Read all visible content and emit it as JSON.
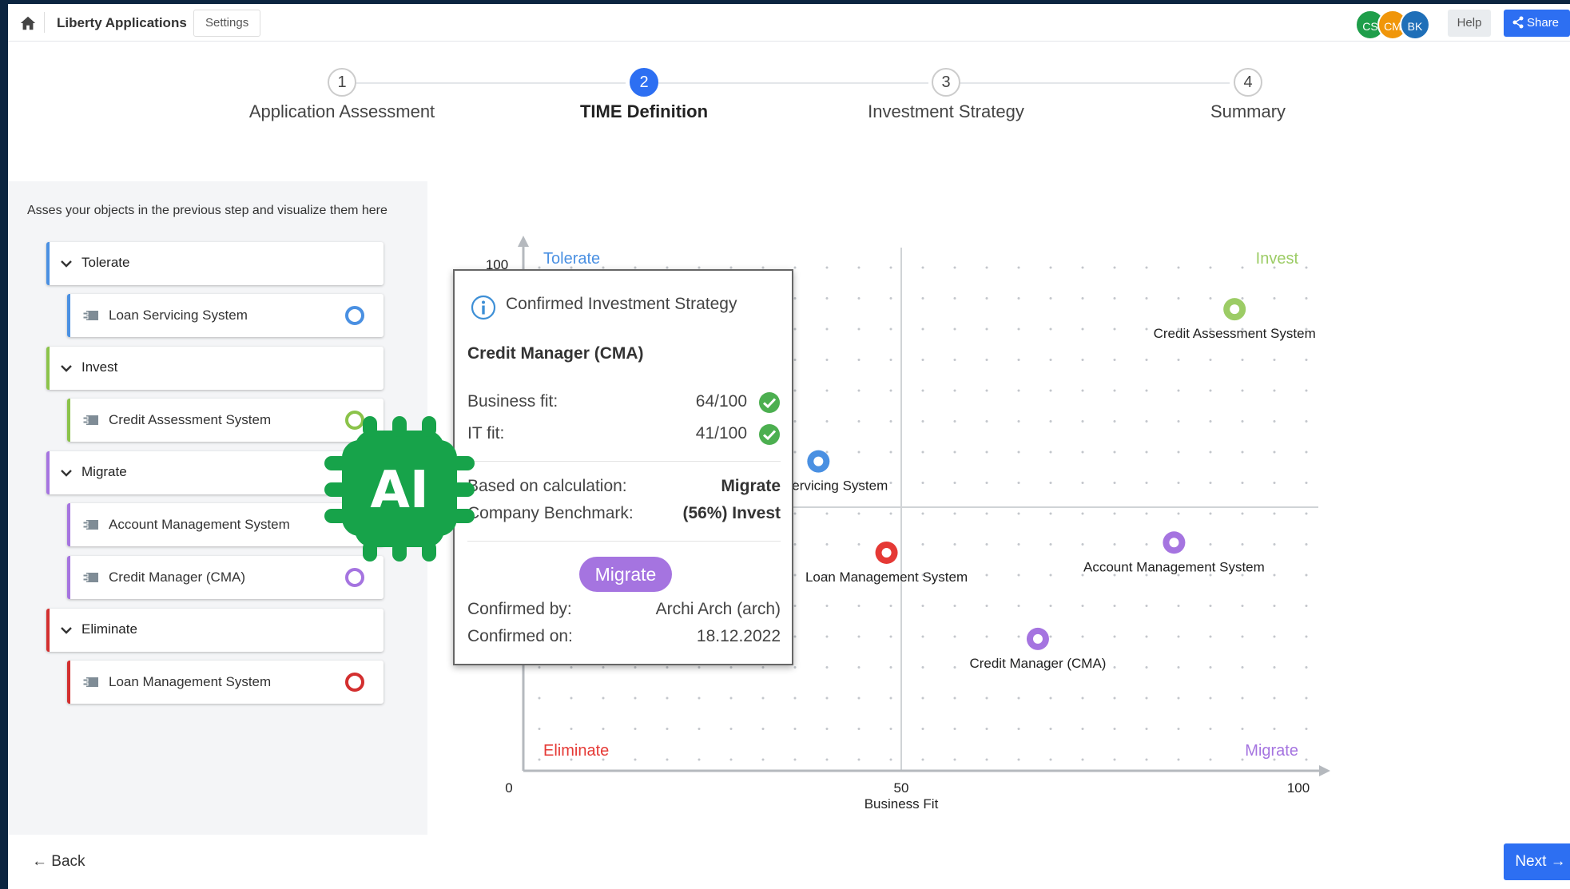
{
  "topbar": {
    "home_icon": "home-icon",
    "app_title": "Liberty Applications",
    "settings_label": "Settings",
    "avatars": [
      {
        "initials": "CS",
        "color": "#1e9e4a"
      },
      {
        "initials": "CM",
        "color": "#f0960a"
      },
      {
        "initials": "BK",
        "color": "#1f6fb8"
      }
    ],
    "help_label": "Help",
    "share_label": "Share"
  },
  "stepper": {
    "steps": [
      {
        "number": "1",
        "label": "Application Assessment",
        "active": false
      },
      {
        "number": "2",
        "label": "TIME Definition",
        "active": true
      },
      {
        "number": "3",
        "label": "Investment Strategy",
        "active": false
      },
      {
        "number": "4",
        "label": "Summary",
        "active": false
      }
    ]
  },
  "left_panel": {
    "intro": "Asses your objects in the previous step and visualize them here",
    "groups": [
      {
        "label": "Tolerate",
        "color": "#4a90e2",
        "items": [
          {
            "label": "Loan Servicing System"
          }
        ]
      },
      {
        "label": "Invest",
        "color": "#8bc34a",
        "items": [
          {
            "label": "Credit Assessment System"
          }
        ]
      },
      {
        "label": "Migrate",
        "color": "#a574e0",
        "items": [
          {
            "label": "Account Management System"
          },
          {
            "label": "Credit Manager (CMA)"
          }
        ]
      },
      {
        "label": "Eliminate",
        "color": "#d32f2f",
        "items": [
          {
            "label": "Loan Management System"
          }
        ]
      }
    ]
  },
  "chart_data": {
    "type": "scatter",
    "xlabel": "Business Fit",
    "ylabel": "",
    "xlim": [
      0,
      100
    ],
    "ylim": [
      0,
      100
    ],
    "x_ticks": [
      "0",
      "50",
      "100"
    ],
    "y_ticks": [
      "100"
    ],
    "grid": true,
    "quadrants": [
      {
        "label": "Tolerate",
        "position": "top-left",
        "color": "#4a90e2"
      },
      {
        "label": "Invest",
        "position": "top-right",
        "color": "#9ccc65"
      },
      {
        "label": "Eliminate",
        "position": "bottom-left",
        "color": "#e53935"
      },
      {
        "label": "Migrate",
        "position": "bottom-right",
        "color": "#a574e0"
      }
    ],
    "points": [
      {
        "label": "Credit Assessment System",
        "x": 94,
        "y": 91,
        "color": "#9ccc65"
      },
      {
        "label": "Loan Servicing System",
        "x": 39,
        "y": 61,
        "color": "#4a90e2"
      },
      {
        "label": "Loan Management System",
        "x": 48,
        "y": 43,
        "color": "#e53935"
      },
      {
        "label": "Account Management System",
        "x": 86,
        "y": 45,
        "color": "#a574e0"
      },
      {
        "label": "Credit Manager (CMA)",
        "x": 68,
        "y": 26,
        "color": "#a574e0"
      }
    ]
  },
  "popup": {
    "icon": "info-icon",
    "title": "Confirmed Investment Strategy",
    "app_name": "Credit Manager (CMA)",
    "business_fit_label": "Business fit:",
    "business_fit_value": "64/100",
    "it_fit_label": "IT fit:",
    "it_fit_value": "41/100",
    "calculation_label": "Based on calculation:",
    "calculation_value": "Migrate",
    "benchmark_label": "Company Benchmark:",
    "benchmark_value": "(56%) Invest",
    "badge": "Migrate",
    "confirmed_by_label": "Confirmed by:",
    "confirmed_by_value": "Archi Arch (arch)",
    "confirmed_on_label": "Confirmed on:",
    "confirmed_on_value": "18.12.2022"
  },
  "overlay": {
    "ai_chip_text": "AI",
    "ai_chip_color": "#17a34a"
  },
  "footer": {
    "back_label": "Back",
    "next_label": "Next"
  }
}
